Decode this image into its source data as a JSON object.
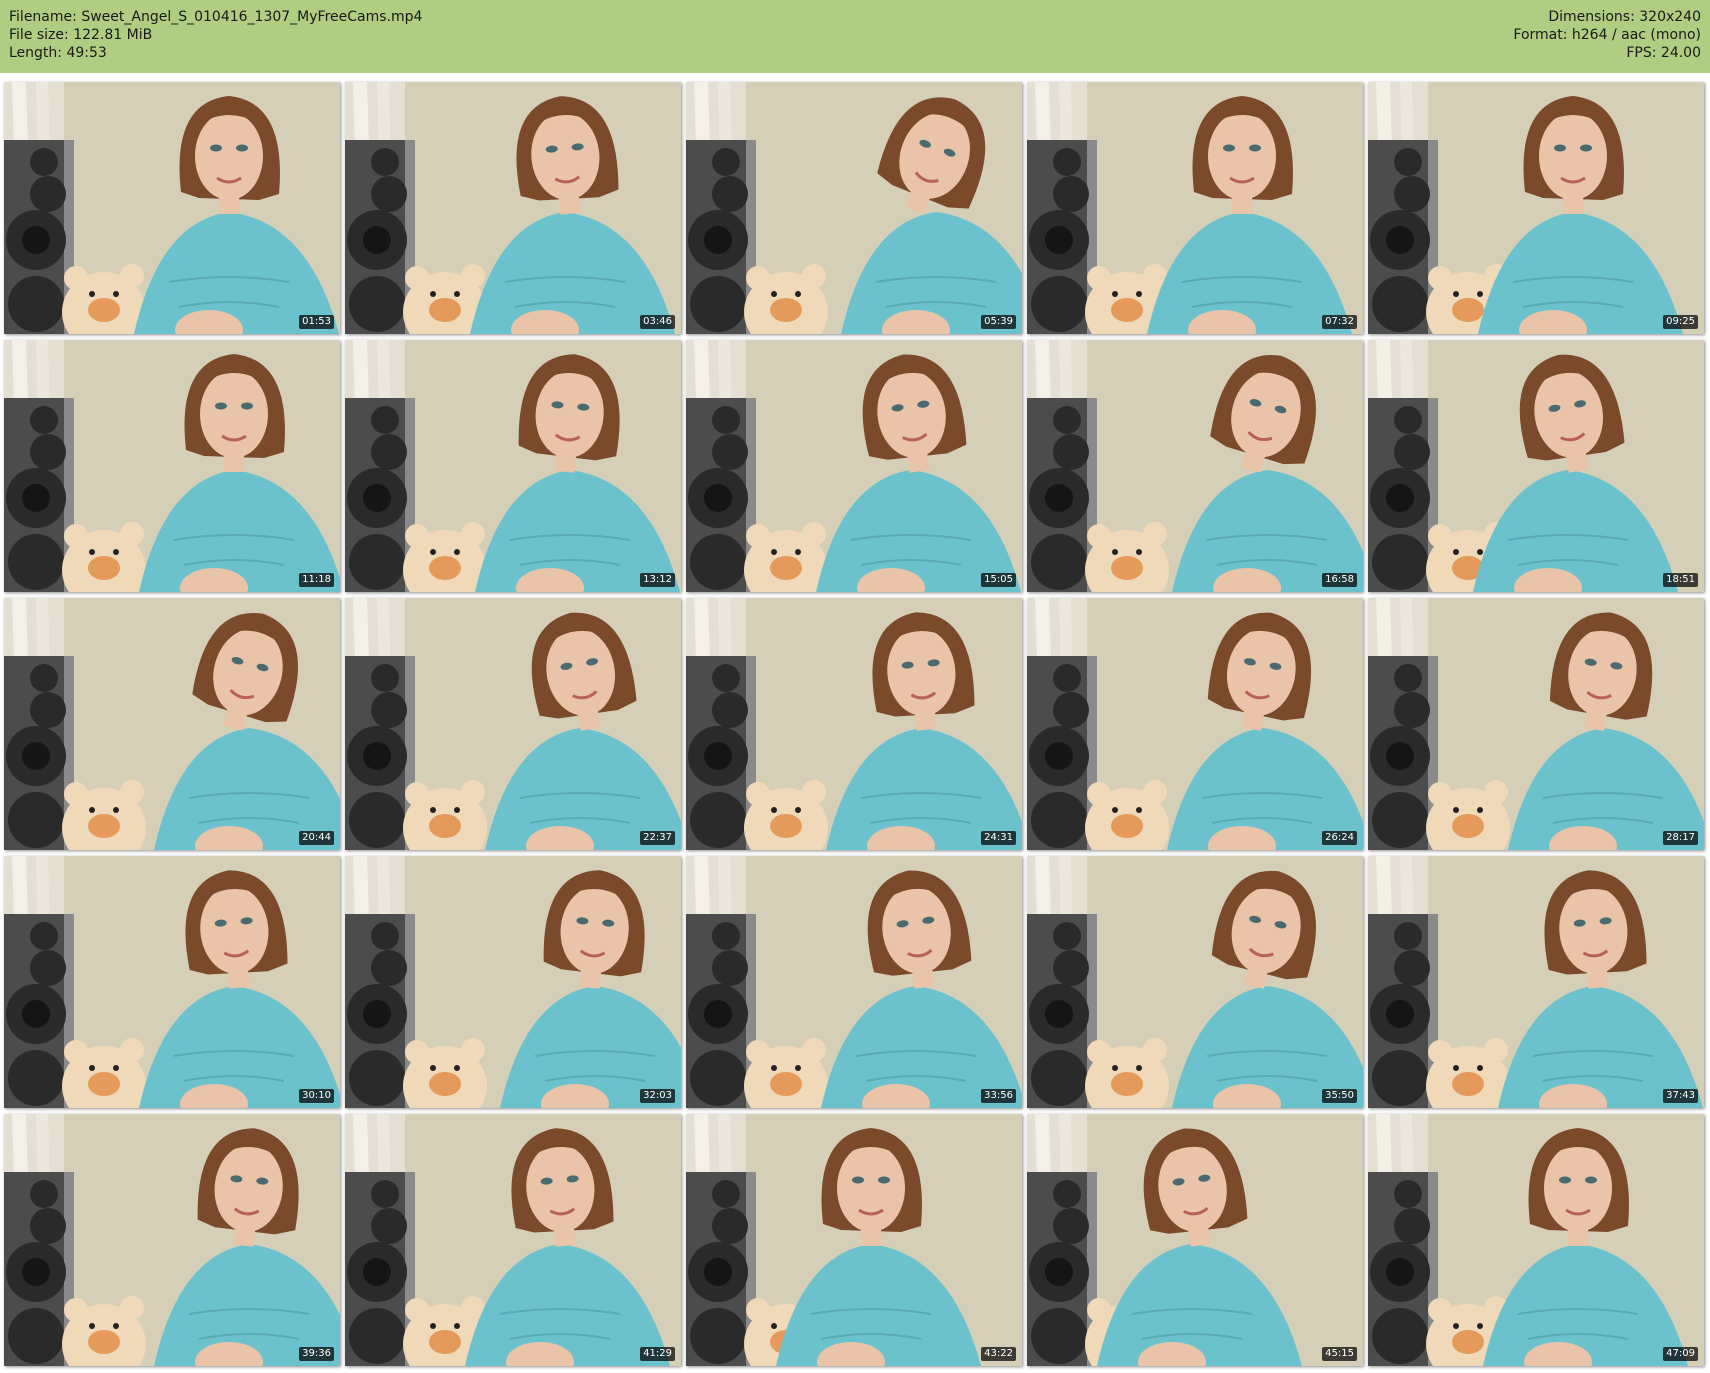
{
  "header": {
    "left": [
      {
        "label": "Filename:",
        "value": "Sweet_Angel_S_010416_1307_MyFreeCams.mp4"
      },
      {
        "label": "File size:",
        "value": "122.81 MiB"
      },
      {
        "label": "Length:",
        "value": "49:53"
      }
    ],
    "right": [
      {
        "label": "Dimensions:",
        "value": "320x240"
      },
      {
        "label": "Format:",
        "value": "h264 / aac (mono)"
      },
      {
        "label": "FPS:",
        "value": "24.00"
      }
    ]
  },
  "thumbnails": [
    {
      "timestamp": "01:53"
    },
    {
      "timestamp": "03:46"
    },
    {
      "timestamp": "05:39"
    },
    {
      "timestamp": "07:32"
    },
    {
      "timestamp": "09:25"
    },
    {
      "timestamp": "11:18"
    },
    {
      "timestamp": "13:12"
    },
    {
      "timestamp": "15:05"
    },
    {
      "timestamp": "16:58"
    },
    {
      "timestamp": "18:51"
    },
    {
      "timestamp": "20:44"
    },
    {
      "timestamp": "22:37"
    },
    {
      "timestamp": "24:31"
    },
    {
      "timestamp": "26:24"
    },
    {
      "timestamp": "28:17"
    },
    {
      "timestamp": "30:10"
    },
    {
      "timestamp": "32:03"
    },
    {
      "timestamp": "33:56"
    },
    {
      "timestamp": "35:50"
    },
    {
      "timestamp": "37:43"
    },
    {
      "timestamp": "39:36"
    },
    {
      "timestamp": "41:29"
    },
    {
      "timestamp": "43:22"
    },
    {
      "timestamp": "45:15"
    },
    {
      "timestamp": "47:09"
    }
  ],
  "colors": {
    "header_bg": "#b0cd82",
    "wall": "#d6cfb8",
    "sweater": "#6cc2cc",
    "hair": "#7a4a2a",
    "skin": "#e9c4a8",
    "speaker": "#2a2a2a",
    "teddy": "#f0d9b8"
  }
}
